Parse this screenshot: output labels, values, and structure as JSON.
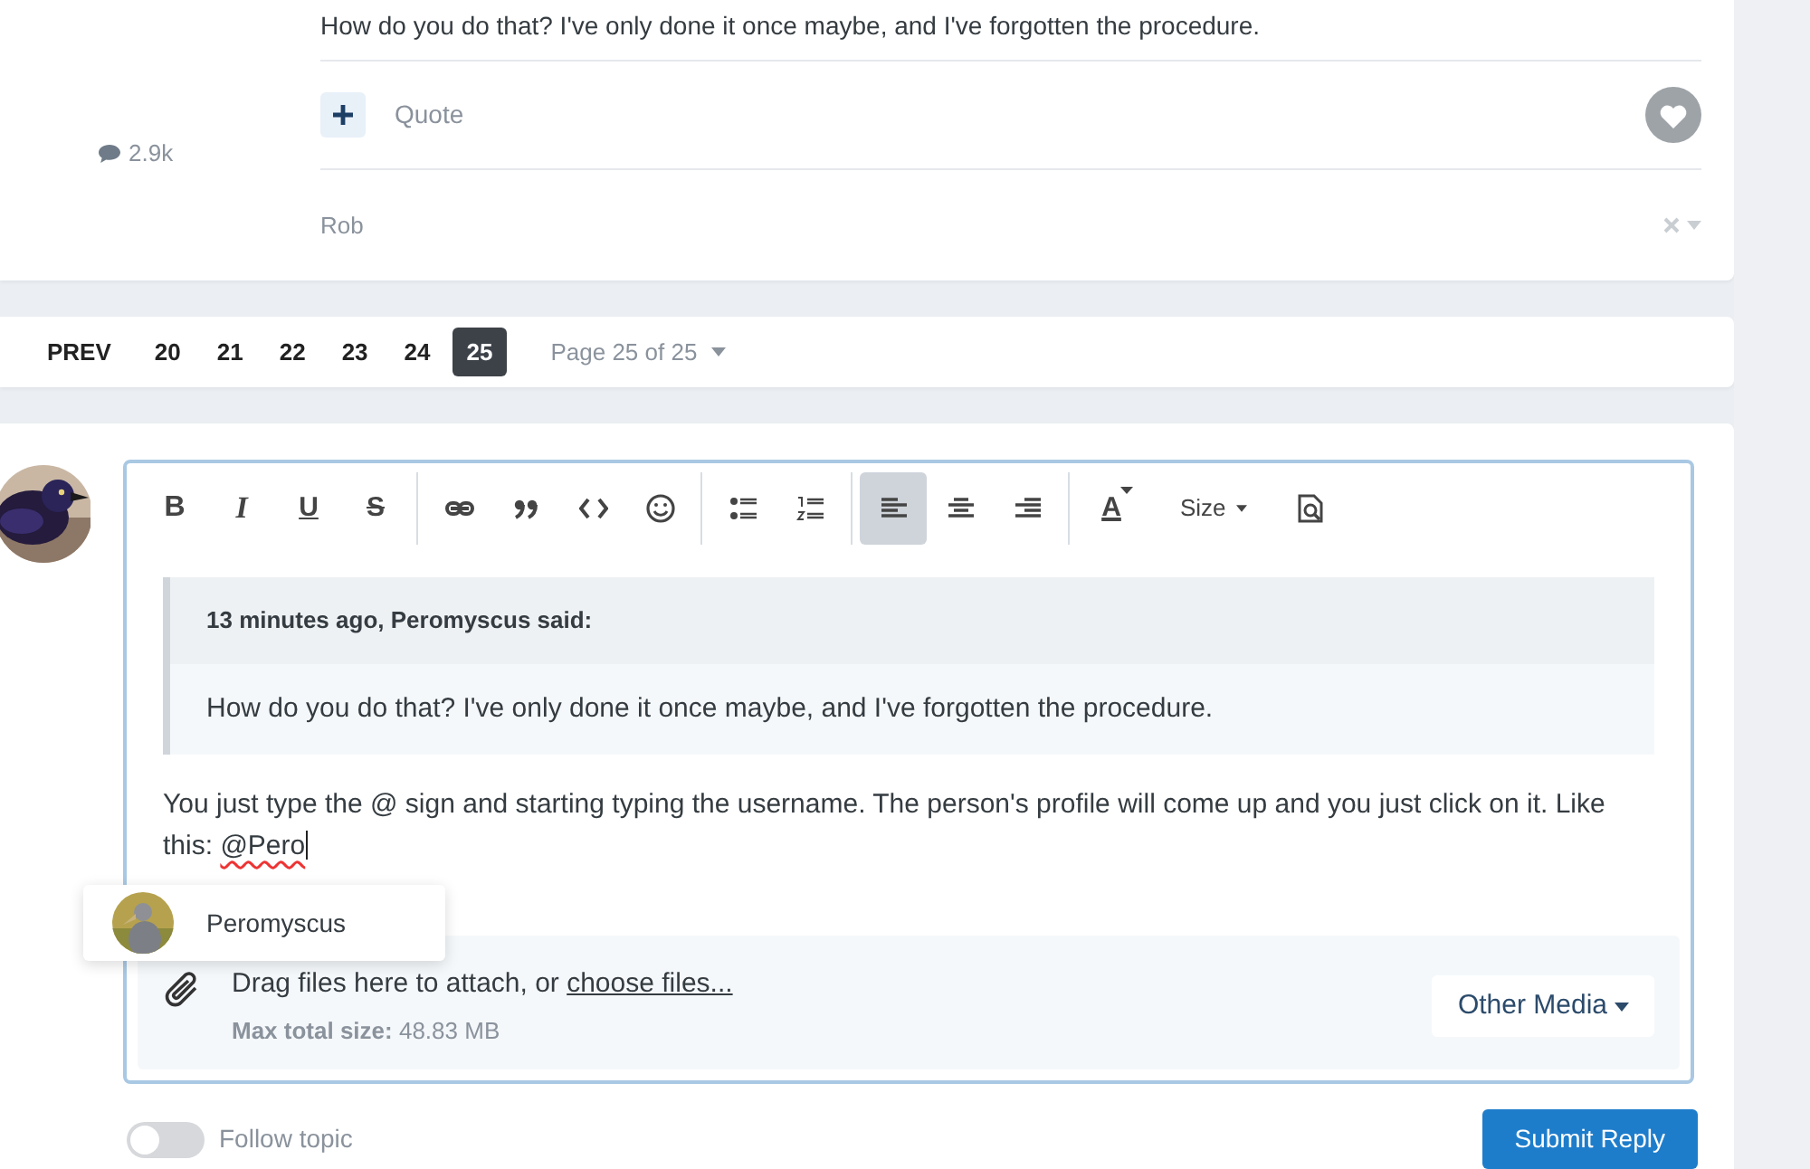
{
  "post": {
    "text": "How do you do that? I've only done it once maybe, and I've forgotten the procedure.",
    "comment_count": "2.9k",
    "quote_label": "Quote",
    "signature": "Rob"
  },
  "pagination": {
    "prev": "PREV",
    "pages": [
      {
        "label": "20",
        "selected": false
      },
      {
        "label": "21",
        "selected": false
      },
      {
        "label": "22",
        "selected": false
      },
      {
        "label": "23",
        "selected": false
      },
      {
        "label": "24",
        "selected": false
      },
      {
        "label": "25",
        "selected": true
      }
    ],
    "page_menu": "Page 25 of 25"
  },
  "editor": {
    "toolbar": [
      {
        "kind": "letter",
        "label": "B",
        "selected": false
      },
      {
        "kind": "letter",
        "label": "I",
        "selected": false
      },
      {
        "kind": "letter",
        "label": "U",
        "selected": false
      },
      {
        "kind": "letter",
        "label": "S",
        "selected": false
      },
      {
        "kind": "separator"
      },
      {
        "kind": "icon",
        "selected": false
      },
      {
        "kind": "icon",
        "selected": false
      },
      {
        "kind": "icon",
        "selected": false
      },
      {
        "kind": "icon",
        "selected": false
      },
      {
        "kind": "separator"
      },
      {
        "kind": "icon",
        "selected": false
      },
      {
        "kind": "icon",
        "selected": false
      },
      {
        "kind": "separator"
      },
      {
        "kind": "icon",
        "selected": true
      },
      {
        "kind": "icon",
        "selected": false
      },
      {
        "kind": "icon",
        "selected": false
      },
      {
        "kind": "separator"
      },
      {
        "kind": "color",
        "label": "A",
        "selected": false
      },
      {
        "kind": "dropdown",
        "label": "Size",
        "selected": false
      },
      {
        "kind": "icon",
        "selected": false
      }
    ],
    "quote": {
      "header": "13 minutes ago, Peromyscus said:",
      "body": "How do you do that? I've only done it once maybe, and I've forgotten the procedure."
    },
    "text": "You just type the @ sign and starting typing the username. The person's profile will come up and you just click on it. Like this: ",
    "mention_draft": "@Pero",
    "mention_popup": {
      "name": "Peromyscus"
    },
    "attach": {
      "text": "Drag files here to attach, or ",
      "link": "choose files...",
      "limit": "**Max total size:** 48.83 MB",
      "media_button": "Other Media"
    }
  },
  "follow": {
    "label": "Follow topic",
    "on": false
  },
  "submit": "Submit Reply"
}
